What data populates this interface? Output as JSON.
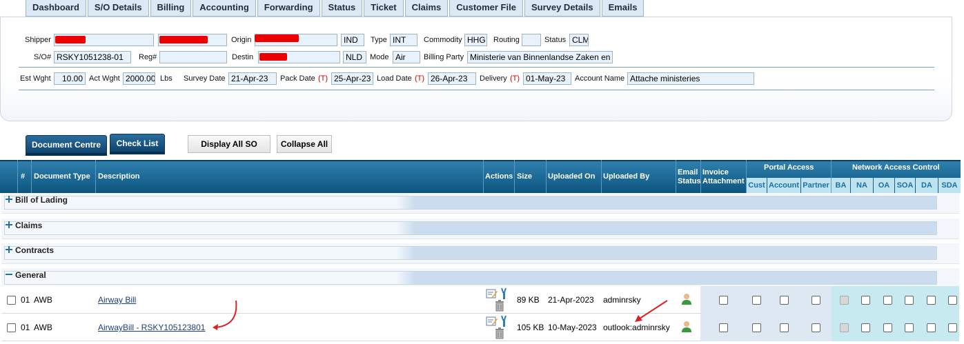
{
  "tabs": [
    "Dashboard",
    "S/O Details",
    "Billing",
    "Accounting",
    "Forwarding",
    "Status",
    "Ticket",
    "Claims",
    "Customer File",
    "Survey Details",
    "Emails"
  ],
  "header": {
    "shipper_label": "Shipper",
    "origin_label": "Origin",
    "origin_code": "IND",
    "type_label": "Type",
    "type_value": "INT",
    "commodity_label": "Commodity",
    "commodity_value": "HHG",
    "routing_label": "Routing",
    "routing_value": "",
    "status_label": "Status",
    "status_value": "CLM",
    "so_label": "S/O#",
    "so_value": "RSKY1051238-01",
    "reg_label": "Reg#",
    "reg_value": "",
    "destin_label": "Destin",
    "destin_code": "NLD",
    "mode_label": "Mode",
    "mode_value": "Air",
    "billing_party_label": "Billing Party",
    "billing_party_value": "Ministerie van Binnenlandse Zaken en",
    "est_wght_label": "Est Wght",
    "est_wght_value": "10.00",
    "act_wght_label": "Act Wght",
    "act_wght_value": "2000.00",
    "lbs_label": "Lbs",
    "survey_date_label": "Survey Date",
    "survey_date_value": "21-Apr-23",
    "pack_date_label": "Pack Date",
    "pack_date_value": "25-Apr-23",
    "load_date_label": "Load Date",
    "load_date_value": "26-Apr-23",
    "delivery_label": "Delivery",
    "delivery_value": "01-May-23",
    "t_marker": "(T)",
    "account_name_label": "Account Name",
    "account_name_value": "Attache ministeries"
  },
  "buttons": {
    "document_centre": "Document Centre",
    "check_list": "Check List",
    "display_all_so": "Display All SO",
    "collapse_all": "Collapse All"
  },
  "grid": {
    "col_hash": "#",
    "col_doc_type": "Document Type",
    "col_description": "Description",
    "col_actions": "Actions",
    "col_size": "Size",
    "col_uploaded_on": "Uploaded On",
    "col_uploaded_by": "Uploaded By",
    "col_email_1": "Email",
    "col_email_2": "Status",
    "col_invoice_1": "Invoice",
    "col_invoice_2": "Attachment",
    "portal_access": "Portal Access",
    "portal_cols": [
      "Cust",
      "Account",
      "Partner"
    ],
    "network_access": "Network Access Control",
    "network_cols": [
      "BA",
      "NA",
      "OA",
      "SOA",
      "DA",
      "SDA"
    ],
    "groups": [
      "Bill of Lading",
      "Claims",
      "Contracts",
      "General"
    ],
    "rows": [
      {
        "num": "01",
        "doc_type": "AWB",
        "description": "Airway Bill",
        "size": "89 KB",
        "uploaded_on": "21-Apr-2023",
        "uploaded_by": "adminrsky"
      },
      {
        "num": "01",
        "doc_type": "AWB",
        "description": "AirwayBill - RSKY105123801",
        "size": "105 KB",
        "uploaded_on": "10-May-2023",
        "uploaded_by": "outlook:adminrsky"
      }
    ]
  },
  "colors": {
    "header_blue": "#0d557f",
    "tab_bg": "#dce9f5",
    "annotation_red": "#e02020"
  }
}
